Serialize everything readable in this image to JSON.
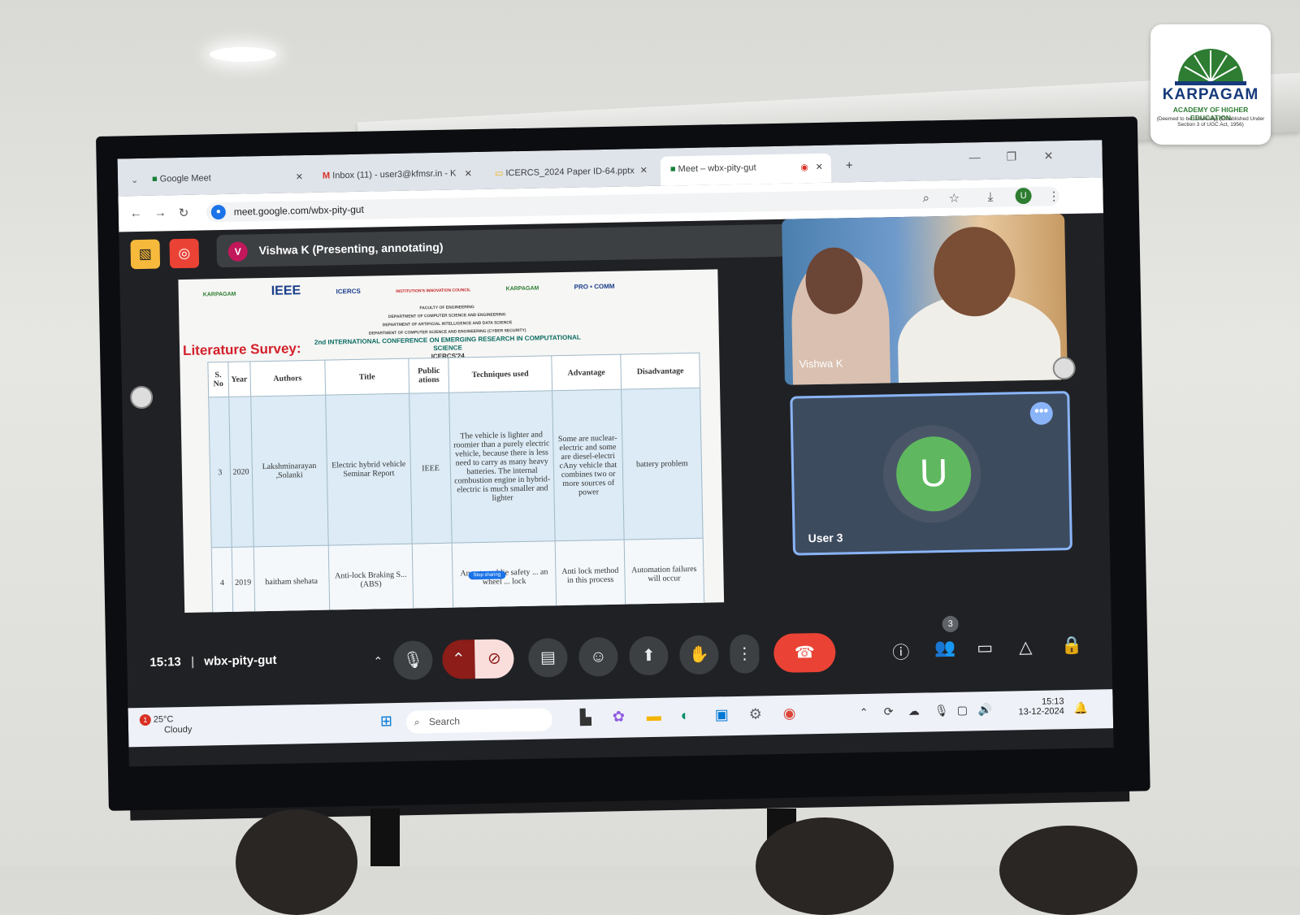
{
  "logo": {
    "name": "KARPAGAM",
    "sub": "ACADEMY OF HIGHER EDUCATION",
    "sub2": "(Deemed to be University) (Established Under Section 3 of UGC Act, 1956)"
  },
  "browser": {
    "tabs": [
      {
        "label": "Google Meet",
        "icon": "meet-icon"
      },
      {
        "label": "Inbox (11) - user3@kfmsr.in - K",
        "icon": "gmail-icon"
      },
      {
        "label": "ICERCS_2024 Paper ID-64.pptx",
        "icon": "slides-icon"
      },
      {
        "label": "Meet – wbx-pity-gut",
        "icon": "meet-icon"
      }
    ],
    "new_tab": "+",
    "url": "meet.google.com/wbx-pity-gut",
    "profile": "U"
  },
  "meet": {
    "presenter_avatar": "V",
    "presenter_label": "Vishwa K (Presenting, annotating)",
    "slide": {
      "logos": [
        "KARPAGAM",
        "IEEE",
        "ICERCS",
        "INSTITUTION'S INNOVATION COUNCIL",
        "KARPAGAM",
        "PRO • COMM"
      ],
      "department_lines": [
        "FACULTY OF ENGINEERING",
        "DEPARTMENT OF COMPUTER SCIENCE AND ENGINEERING",
        "DEPARTMENT OF ARTIFICIAL INTELLIGENCE AND DATA SCIENCE",
        "DEPARTMENT OF COMPUTER SCIENCE AND ENGINEERING (CYBER SECURITY)"
      ],
      "conference": "2nd INTERNATIONAL CONFERENCE ON EMERGING RESEARCH IN COMPUTATIONAL SCIENCE",
      "conference_short": "ICERCS'24",
      "heading": "Literature Survey:",
      "columns": [
        "S. No",
        "Year",
        "Authors",
        "Title",
        "Public ations",
        "Techniques used",
        "Advantage",
        "Disadvantage"
      ],
      "rows": [
        [
          "3",
          "2020",
          "Lakshminarayan ,Solanki",
          "Electric hybrid vehicle Seminar Report",
          "IEEE",
          "The vehicle is lighter and roomier than a purely electric vehicle, because there is less need to carry as many heavy batteries. The internal combustion engine in hybrid-electric is much smaller and lighter",
          "Some are nuclear-electric and some are diesel-electri cAny vehicle that combines two or more sources of power",
          "battery problem"
        ],
        [
          "4",
          "2019",
          "haitham shehata",
          "Anti-lock Braking S... (ABS)",
          "",
          "An automoblie safety ... an wheel ... lock",
          "Anti lock method in this process",
          "Automation failures will occur"
        ]
      ],
      "share_bar": "Stop sharing"
    },
    "tiles": [
      {
        "name": "Vishwa K"
      },
      {
        "name": "User 3",
        "initial": "U"
      }
    ],
    "time": "15:13",
    "meeting_code": "wbx-pity-gut",
    "participants_count": "3"
  },
  "taskbar": {
    "weather_temp": "25°C",
    "weather_cond": "Cloudy",
    "weather_badge": "1",
    "search": "Search",
    "time": "15:13",
    "date": "13-12-2024"
  },
  "colors": {
    "meet_bg": "#202124",
    "end_call": "#ea4335",
    "record": "#ea4335",
    "annotate": "#f6b93b",
    "avatar_u": "#5fb85f"
  }
}
